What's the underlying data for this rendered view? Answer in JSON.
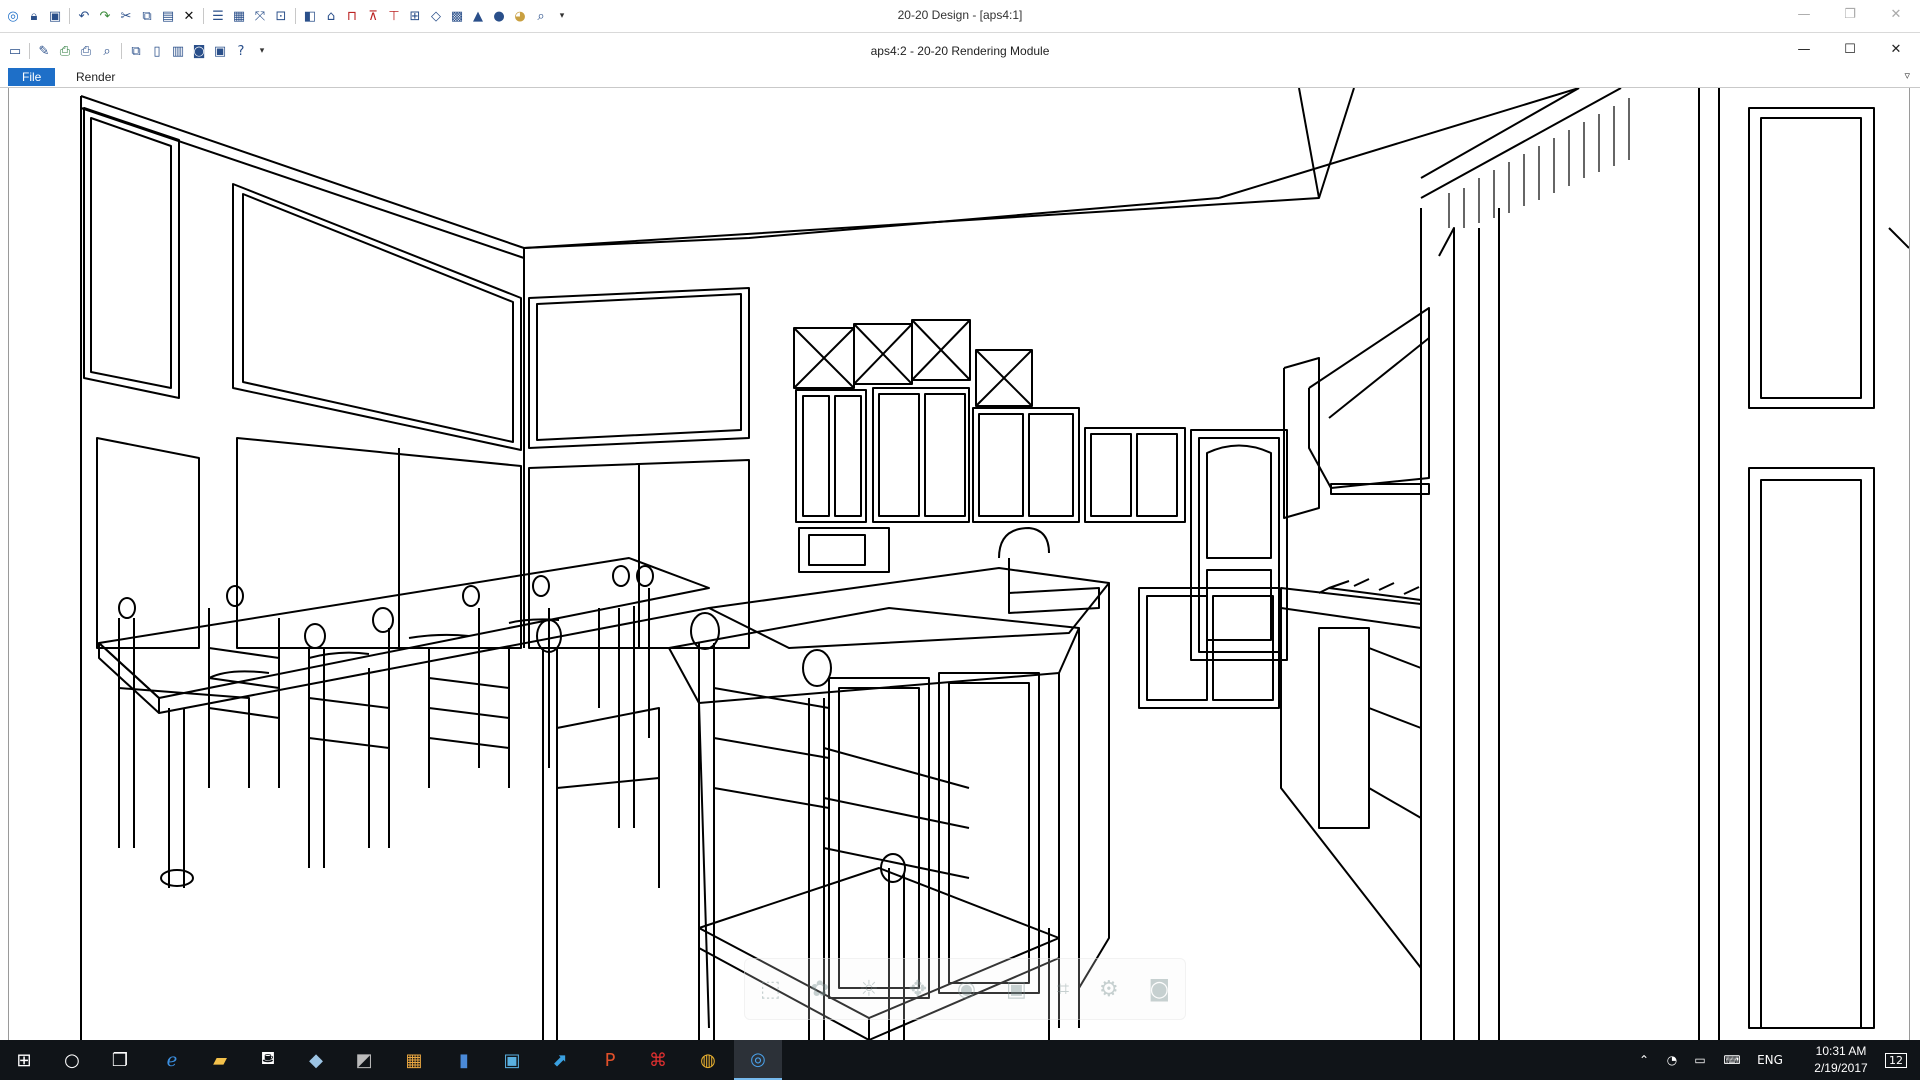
{
  "outer_window": {
    "title": "20-20 Design - [aps4:1]",
    "minimize": "—",
    "maximize": "❐",
    "close": "✕"
  },
  "inner_window": {
    "title": "aps4:2 - 20-20 Rendering Module",
    "minimize": "—",
    "maximize": "☐",
    "close": "✕"
  },
  "menu": {
    "file": "File",
    "render": "Render",
    "chevron": "▿"
  },
  "toolbar_icons_outer": [
    "app-icon",
    "lock-icon",
    "save-icon",
    "undo-icon",
    "redo-icon",
    "cut-icon",
    "copy-icon",
    "paste-icon",
    "delete-icon",
    "list-icon",
    "grid-icon",
    "fit-icon",
    "zoom-window-icon",
    "cube-icon",
    "view-3d-icon",
    "plan-icon",
    "elevation-icon",
    "dimension-icon",
    "table-icon",
    "rotate-icon",
    "grid-small-icon",
    "render-icon",
    "sphere-icon",
    "palette-icon",
    "zoom-icon"
  ],
  "toolbar_icons_inner": [
    "window-icon",
    "edit-icon",
    "print-setup-icon",
    "print-icon",
    "preview-icon",
    "copy-image-icon",
    "page-icon",
    "layout-icon",
    "camera-icon",
    "export-icon",
    "help-icon"
  ],
  "render_toolbar_icons": [
    "select-icon",
    "color-icon",
    "light-icon",
    "move-icon",
    "orbit-icon",
    "frame-icon",
    "plan-view-icon",
    "camera-settings-icon",
    "snapshot-icon"
  ],
  "taskbar": {
    "apps": [
      "start-icon",
      "cortana-icon",
      "task-view-icon",
      "edge-icon",
      "file-explorer-icon",
      "store-icon",
      "app-icon-1",
      "app-icon-2",
      "app-icon-3",
      "app-icon-4",
      "app-icon-5",
      "app-icon-6",
      "powerpoint-icon",
      "acrobat-icon",
      "chrome-icon",
      "20-20-icon"
    ],
    "lang": "ENG",
    "time": "10:31 AM",
    "date": "2/19/2017",
    "notifications": "12"
  }
}
